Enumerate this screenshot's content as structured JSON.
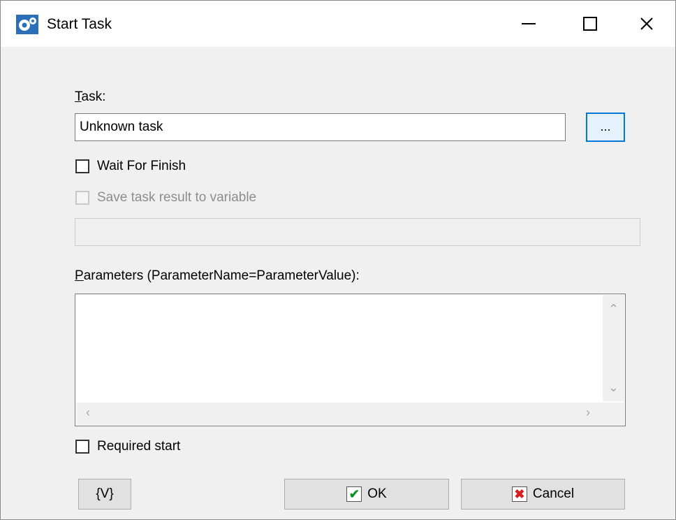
{
  "window": {
    "title": "Start Task",
    "icon": "gears-icon",
    "controls": {
      "minimize": "minimize-icon",
      "maximize": "maximize-icon",
      "close": "close-icon"
    }
  },
  "task": {
    "label_first": "T",
    "label_rest": "ask:",
    "value": "Unknown task",
    "browse_label": "..."
  },
  "wait_for_finish": {
    "label": "Wait For Finish",
    "checked": false
  },
  "save_result": {
    "label": "Save task result to variable",
    "checked": false,
    "enabled": false,
    "value": ""
  },
  "parameters": {
    "label_first": "P",
    "label_rest": "arameters (ParameterName=ParameterValue):",
    "value": ""
  },
  "required_start": {
    "label": "Required start",
    "checked": false
  },
  "buttons": {
    "variables": "{V}",
    "ok": "OK",
    "cancel": "Cancel"
  },
  "colors": {
    "focus_border": "#0078d7",
    "ok_check": "#12922a",
    "cancel_x": "#d81f1f"
  }
}
